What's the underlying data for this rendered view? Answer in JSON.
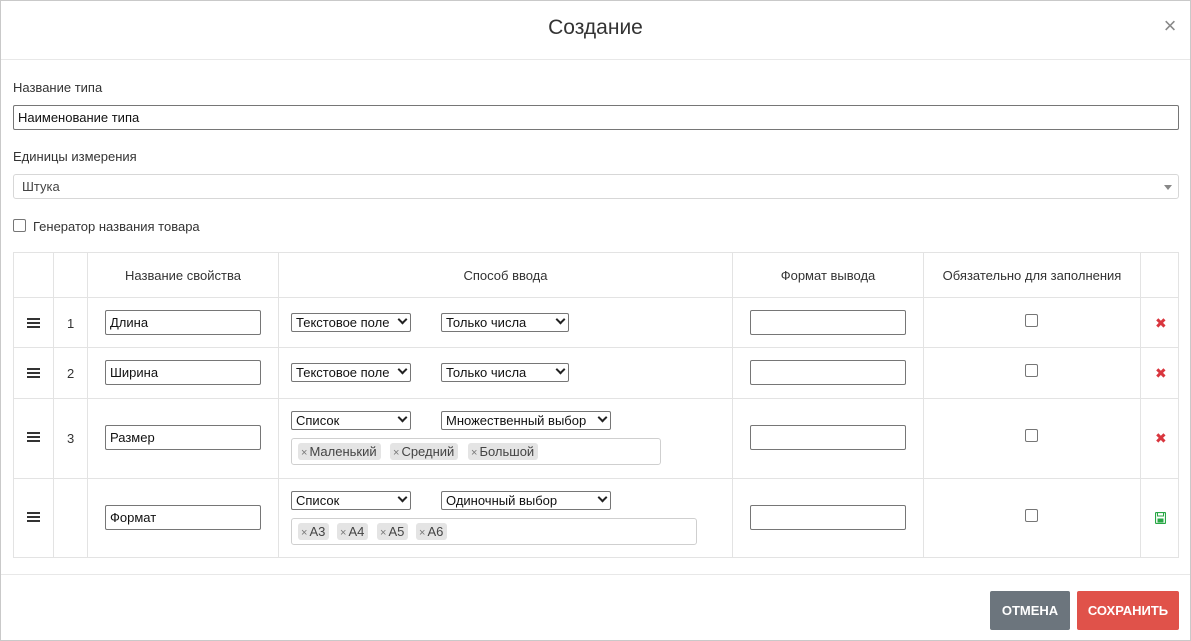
{
  "dialog": {
    "title": "Создание",
    "close_symbol": "×"
  },
  "form": {
    "type_name_label": "Название типа",
    "type_name_value": "Наименование типа",
    "units_label": "Единицы измерения",
    "units_value": "Штука",
    "generator_label": "Генератор названия товара",
    "generator_checked": false
  },
  "table": {
    "headers": [
      "",
      "",
      "Название свойства",
      "Способ ввода",
      "Формат вывода",
      "Обязательно для заполнения",
      ""
    ],
    "rows": [
      {
        "num": "1",
        "name": "Длина",
        "input_method": "Текстовое поле",
        "input_subtype": "Только числа",
        "tags": [],
        "output_format": "",
        "required": false,
        "action": "delete-icon"
      },
      {
        "num": "2",
        "name": "Ширина",
        "input_method": "Текстовое поле",
        "input_subtype": "Только числа",
        "tags": [],
        "output_format": "",
        "required": false,
        "action": "delete-icon"
      },
      {
        "num": "3",
        "name": "Размер",
        "input_method": "Список",
        "input_subtype": "Множественный выбор",
        "tags": [
          "Маленький",
          "Средний",
          "Большой"
        ],
        "output_format": "",
        "required": false,
        "action": "delete-icon"
      },
      {
        "num": "",
        "name": "Формат",
        "input_method": "Список",
        "input_subtype": "Одиночный выбор",
        "tags": [
          "A3",
          "A4",
          "A5",
          "A6"
        ],
        "output_format": "",
        "required": false,
        "action": "save-icon"
      }
    ],
    "delete_symbol": "✖"
  },
  "footer": {
    "cancel_label": "ОТМЕНА",
    "save_label": "СОХРАНИТЬ"
  },
  "colors": {
    "cancel_bg": "#6c757d",
    "save_bg": "#e0524a",
    "delete_icon": "#d9363e",
    "save_icon": "#28a745"
  }
}
